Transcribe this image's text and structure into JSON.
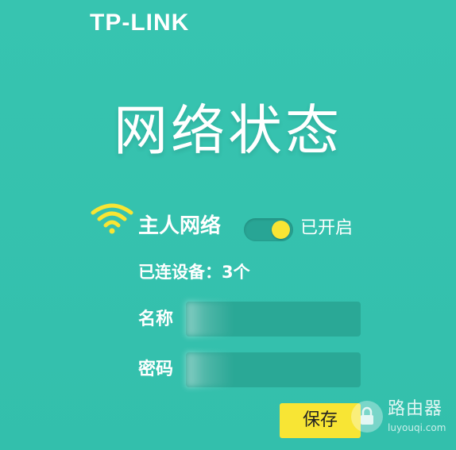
{
  "brand": {
    "logo_text": "TP-LINK"
  },
  "page": {
    "title": "网络状态"
  },
  "network": {
    "name": "主人网络",
    "toggle_on": true,
    "status_text": "已开启",
    "devices_label": "已连设备：",
    "devices_count": "3个"
  },
  "form": {
    "name_label": "名称",
    "name_value": "",
    "password_label": "密码",
    "password_value": "",
    "save_label": "保存"
  },
  "watermark": {
    "text": "路由器",
    "url": "luyouqi.com"
  },
  "icons": {
    "wifi": "wifi-icon",
    "lock": "lock-icon"
  },
  "colors": {
    "background": "#35c2ae",
    "accent_yellow": "#f8e534",
    "input_bg": "#2aa896",
    "toggle_track": "#28a595"
  }
}
